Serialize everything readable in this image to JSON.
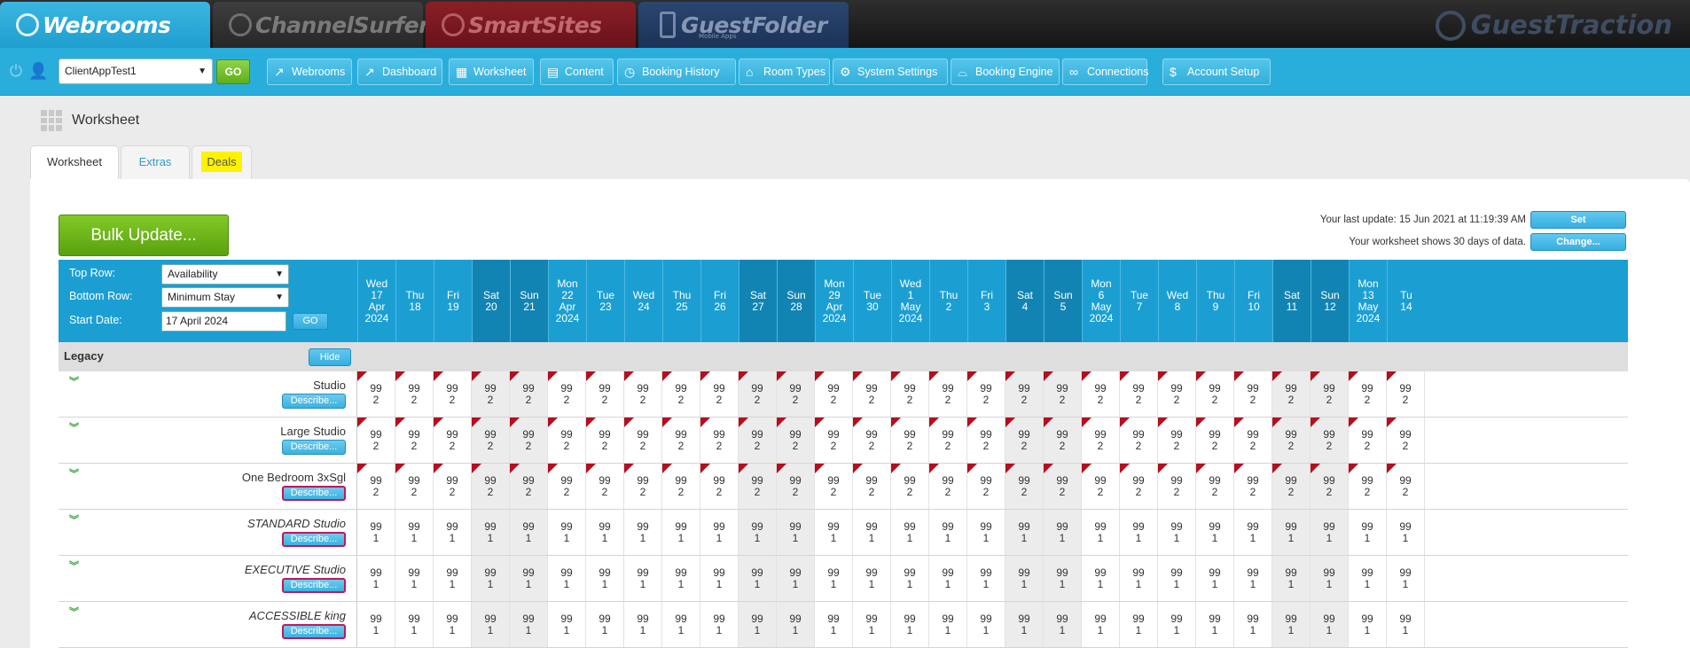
{
  "brand_tabs": [
    {
      "name": "Webrooms",
      "sub": ""
    },
    {
      "name": "ChannelSurfer",
      "sub": ""
    },
    {
      "name": "SmartSites",
      "sub": ""
    },
    {
      "name": "GuestFolder",
      "sub": "Mobile Apps"
    }
  ],
  "brand_right": "GuestTraction",
  "nav": {
    "client": "ClientAppTest1",
    "go_label": "GO",
    "buttons": [
      {
        "label": "Webrooms",
        "icon": "chart-line-icon"
      },
      {
        "label": "Dashboard",
        "icon": "chart-line-icon"
      },
      {
        "label": "Worksheet",
        "icon": "grid-icon"
      },
      {
        "label": "Content",
        "icon": "document-icon"
      },
      {
        "label": "Booking History",
        "icon": "clock-icon"
      },
      {
        "label": "Room Types",
        "icon": "home-icon"
      },
      {
        "label": "System Settings",
        "icon": "gear-icon"
      },
      {
        "label": "Booking Engine",
        "icon": "bell-icon"
      },
      {
        "label": "Connections",
        "icon": "link-icon"
      },
      {
        "label": "Account Setup",
        "icon": "dollar-icon"
      }
    ]
  },
  "page": {
    "title": "Worksheet"
  },
  "tabs": {
    "worksheet": "Worksheet",
    "extras": "Extras",
    "deals": "Deals"
  },
  "toolbar": {
    "bulk_update": "Bulk Update...",
    "last_update": "Your last update: 15 Jun 2021 at 11:19:39 AM",
    "set_label": "Set",
    "days_info": "Your worksheet shows 30 days of data.",
    "change_label": "Change..."
  },
  "controls": {
    "top_row_label": "Top Row:",
    "top_row_value": "Availability",
    "bottom_row_label": "Bottom Row:",
    "bottom_row_value": "Minimum Stay",
    "start_date_label": "Start Date:",
    "start_date_value": "17 April 2024",
    "go_label": "GO"
  },
  "days": [
    {
      "lines": [
        "Wed",
        "17",
        "Apr",
        "2024"
      ],
      "weekend": false
    },
    {
      "lines": [
        "Thu",
        "18"
      ],
      "weekend": false
    },
    {
      "lines": [
        "Fri",
        "19"
      ],
      "weekend": false
    },
    {
      "lines": [
        "Sat",
        "20"
      ],
      "weekend": true
    },
    {
      "lines": [
        "Sun",
        "21"
      ],
      "weekend": true
    },
    {
      "lines": [
        "Mon",
        "22",
        "Apr",
        "2024"
      ],
      "weekend": false
    },
    {
      "lines": [
        "Tue",
        "23"
      ],
      "weekend": false
    },
    {
      "lines": [
        "Wed",
        "24"
      ],
      "weekend": false
    },
    {
      "lines": [
        "Thu",
        "25"
      ],
      "weekend": false
    },
    {
      "lines": [
        "Fri",
        "26"
      ],
      "weekend": false
    },
    {
      "lines": [
        "Sat",
        "27"
      ],
      "weekend": true
    },
    {
      "lines": [
        "Sun",
        "28"
      ],
      "weekend": true
    },
    {
      "lines": [
        "Mon",
        "29",
        "Apr",
        "2024"
      ],
      "weekend": false
    },
    {
      "lines": [
        "Tue",
        "30"
      ],
      "weekend": false
    },
    {
      "lines": [
        "Wed",
        "1",
        "May",
        "2024"
      ],
      "weekend": false
    },
    {
      "lines": [
        "Thu",
        "2"
      ],
      "weekend": false
    },
    {
      "lines": [
        "Fri",
        "3"
      ],
      "weekend": false
    },
    {
      "lines": [
        "Sat",
        "4"
      ],
      "weekend": true
    },
    {
      "lines": [
        "Sun",
        "5"
      ],
      "weekend": true
    },
    {
      "lines": [
        "Mon",
        "6",
        "May",
        "2024"
      ],
      "weekend": false
    },
    {
      "lines": [
        "Tue",
        "7"
      ],
      "weekend": false
    },
    {
      "lines": [
        "Wed",
        "8"
      ],
      "weekend": false
    },
    {
      "lines": [
        "Thu",
        "9"
      ],
      "weekend": false
    },
    {
      "lines": [
        "Fri",
        "10"
      ],
      "weekend": false
    },
    {
      "lines": [
        "Sat",
        "11"
      ],
      "weekend": true
    },
    {
      "lines": [
        "Sun",
        "12"
      ],
      "weekend": true
    },
    {
      "lines": [
        "Mon",
        "13",
        "May",
        "2024"
      ],
      "weekend": false
    },
    {
      "lines": [
        "Tu",
        "14"
      ],
      "weekend": false
    }
  ],
  "group": {
    "name": "Legacy",
    "hide_label": "Hide"
  },
  "describe_label": "Describe...",
  "rooms": [
    {
      "name": "Studio",
      "italic": false,
      "top": "99",
      "bottom": "2",
      "flag": true,
      "alt": false
    },
    {
      "name": "Large Studio",
      "italic": false,
      "top": "99",
      "bottom": "2",
      "flag": true,
      "alt": false
    },
    {
      "name": "One Bedroom 3xSgl",
      "italic": false,
      "top": "99",
      "bottom": "2",
      "flag": true,
      "alt": true
    },
    {
      "name": "STANDARD Studio",
      "italic": true,
      "top": "99",
      "bottom": "1",
      "flag": false,
      "alt": true
    },
    {
      "name": "EXECUTIVE Studio",
      "italic": true,
      "top": "99",
      "bottom": "1",
      "flag": false,
      "alt": true
    },
    {
      "name": "ACCESSIBLE king",
      "italic": true,
      "top": "99",
      "bottom": "1",
      "flag": false,
      "alt": true
    }
  ]
}
